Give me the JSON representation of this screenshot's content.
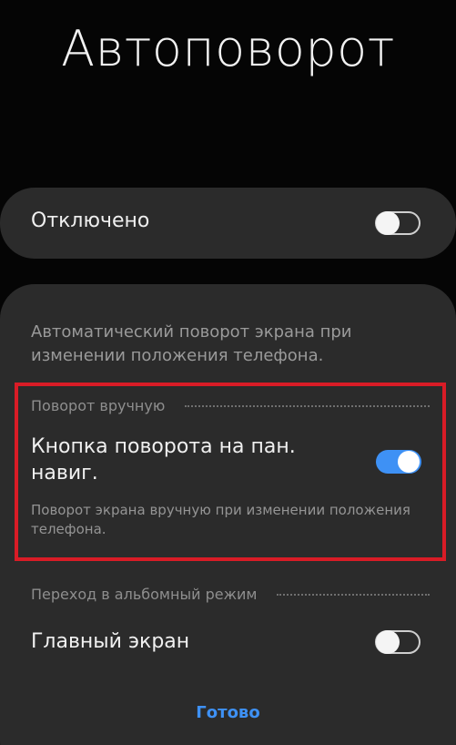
{
  "header": {
    "title": "Автоповорот"
  },
  "master": {
    "label": "Отключено",
    "enabled": false
  },
  "panel": {
    "description": "Автоматический поворот экрана при изменении положения телефона.",
    "manual_section": {
      "header": "Поворот вручную",
      "nav_button_label": "Кнопка поворота на пан. навиг.",
      "nav_button_enabled": true,
      "nav_button_description": "Поворот экрана вручную при изменении положения телефона."
    },
    "landscape_section": {
      "header": "Переход в альбомный режим",
      "home_screen_label": "Главный экран",
      "home_screen_enabled": false
    },
    "done_label": "Готово"
  },
  "colors": {
    "accent": "#3e91f5",
    "highlight_border": "#d91c26",
    "card_background": "#2b2b2b"
  }
}
